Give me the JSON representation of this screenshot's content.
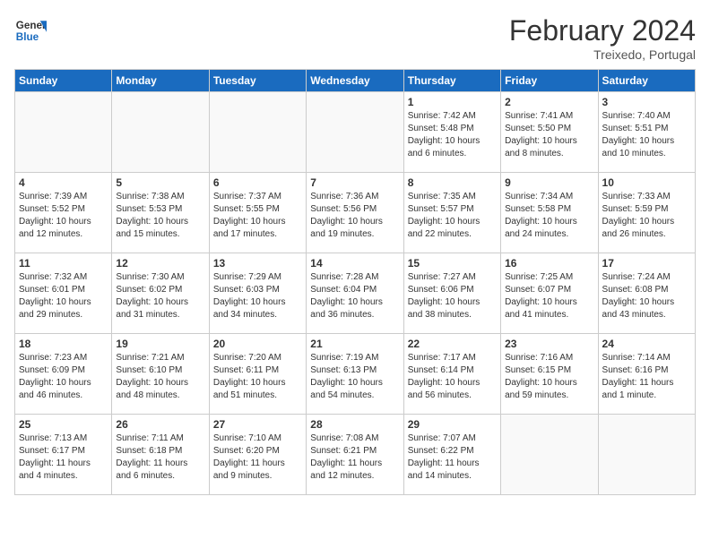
{
  "header": {
    "logo_line1": "General",
    "logo_line2": "Blue",
    "month_year": "February 2024",
    "location": "Treixedo, Portugal"
  },
  "weekdays": [
    "Sunday",
    "Monday",
    "Tuesday",
    "Wednesday",
    "Thursday",
    "Friday",
    "Saturday"
  ],
  "weeks": [
    [
      {
        "day": "",
        "info": ""
      },
      {
        "day": "",
        "info": ""
      },
      {
        "day": "",
        "info": ""
      },
      {
        "day": "",
        "info": ""
      },
      {
        "day": "1",
        "info": "Sunrise: 7:42 AM\nSunset: 5:48 PM\nDaylight: 10 hours\nand 6 minutes."
      },
      {
        "day": "2",
        "info": "Sunrise: 7:41 AM\nSunset: 5:50 PM\nDaylight: 10 hours\nand 8 minutes."
      },
      {
        "day": "3",
        "info": "Sunrise: 7:40 AM\nSunset: 5:51 PM\nDaylight: 10 hours\nand 10 minutes."
      }
    ],
    [
      {
        "day": "4",
        "info": "Sunrise: 7:39 AM\nSunset: 5:52 PM\nDaylight: 10 hours\nand 12 minutes."
      },
      {
        "day": "5",
        "info": "Sunrise: 7:38 AM\nSunset: 5:53 PM\nDaylight: 10 hours\nand 15 minutes."
      },
      {
        "day": "6",
        "info": "Sunrise: 7:37 AM\nSunset: 5:55 PM\nDaylight: 10 hours\nand 17 minutes."
      },
      {
        "day": "7",
        "info": "Sunrise: 7:36 AM\nSunset: 5:56 PM\nDaylight: 10 hours\nand 19 minutes."
      },
      {
        "day": "8",
        "info": "Sunrise: 7:35 AM\nSunset: 5:57 PM\nDaylight: 10 hours\nand 22 minutes."
      },
      {
        "day": "9",
        "info": "Sunrise: 7:34 AM\nSunset: 5:58 PM\nDaylight: 10 hours\nand 24 minutes."
      },
      {
        "day": "10",
        "info": "Sunrise: 7:33 AM\nSunset: 5:59 PM\nDaylight: 10 hours\nand 26 minutes."
      }
    ],
    [
      {
        "day": "11",
        "info": "Sunrise: 7:32 AM\nSunset: 6:01 PM\nDaylight: 10 hours\nand 29 minutes."
      },
      {
        "day": "12",
        "info": "Sunrise: 7:30 AM\nSunset: 6:02 PM\nDaylight: 10 hours\nand 31 minutes."
      },
      {
        "day": "13",
        "info": "Sunrise: 7:29 AM\nSunset: 6:03 PM\nDaylight: 10 hours\nand 34 minutes."
      },
      {
        "day": "14",
        "info": "Sunrise: 7:28 AM\nSunset: 6:04 PM\nDaylight: 10 hours\nand 36 minutes."
      },
      {
        "day": "15",
        "info": "Sunrise: 7:27 AM\nSunset: 6:06 PM\nDaylight: 10 hours\nand 38 minutes."
      },
      {
        "day": "16",
        "info": "Sunrise: 7:25 AM\nSunset: 6:07 PM\nDaylight: 10 hours\nand 41 minutes."
      },
      {
        "day": "17",
        "info": "Sunrise: 7:24 AM\nSunset: 6:08 PM\nDaylight: 10 hours\nand 43 minutes."
      }
    ],
    [
      {
        "day": "18",
        "info": "Sunrise: 7:23 AM\nSunset: 6:09 PM\nDaylight: 10 hours\nand 46 minutes."
      },
      {
        "day": "19",
        "info": "Sunrise: 7:21 AM\nSunset: 6:10 PM\nDaylight: 10 hours\nand 48 minutes."
      },
      {
        "day": "20",
        "info": "Sunrise: 7:20 AM\nSunset: 6:11 PM\nDaylight: 10 hours\nand 51 minutes."
      },
      {
        "day": "21",
        "info": "Sunrise: 7:19 AM\nSunset: 6:13 PM\nDaylight: 10 hours\nand 54 minutes."
      },
      {
        "day": "22",
        "info": "Sunrise: 7:17 AM\nSunset: 6:14 PM\nDaylight: 10 hours\nand 56 minutes."
      },
      {
        "day": "23",
        "info": "Sunrise: 7:16 AM\nSunset: 6:15 PM\nDaylight: 10 hours\nand 59 minutes."
      },
      {
        "day": "24",
        "info": "Sunrise: 7:14 AM\nSunset: 6:16 PM\nDaylight: 11 hours\nand 1 minute."
      }
    ],
    [
      {
        "day": "25",
        "info": "Sunrise: 7:13 AM\nSunset: 6:17 PM\nDaylight: 11 hours\nand 4 minutes."
      },
      {
        "day": "26",
        "info": "Sunrise: 7:11 AM\nSunset: 6:18 PM\nDaylight: 11 hours\nand 6 minutes."
      },
      {
        "day": "27",
        "info": "Sunrise: 7:10 AM\nSunset: 6:20 PM\nDaylight: 11 hours\nand 9 minutes."
      },
      {
        "day": "28",
        "info": "Sunrise: 7:08 AM\nSunset: 6:21 PM\nDaylight: 11 hours\nand 12 minutes."
      },
      {
        "day": "29",
        "info": "Sunrise: 7:07 AM\nSunset: 6:22 PM\nDaylight: 11 hours\nand 14 minutes."
      },
      {
        "day": "",
        "info": ""
      },
      {
        "day": "",
        "info": ""
      }
    ]
  ]
}
